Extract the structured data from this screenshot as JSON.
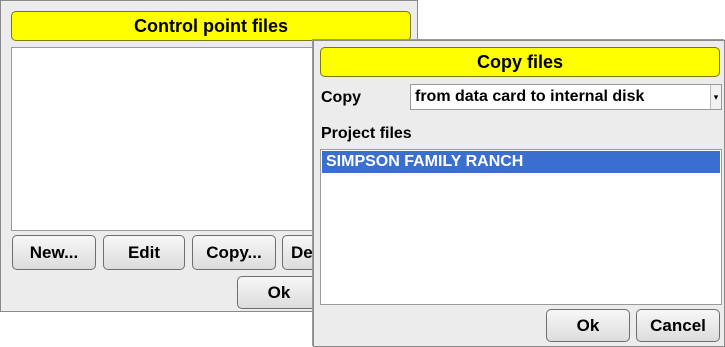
{
  "control_dialog": {
    "title": "Control point files",
    "buttons": {
      "new": "New...",
      "edit": "Edit",
      "copy": "Copy...",
      "delete_partial": "De",
      "ok": "Ok"
    }
  },
  "copy_dialog": {
    "title": "Copy files",
    "copy_label": "Copy",
    "copy_option": "from data card to internal disk",
    "dropdown_arrow": "▾",
    "project_files_label": "Project files",
    "project_files": [
      "SIMPSON FAMILY RANCH"
    ],
    "buttons": {
      "ok": "Ok",
      "cancel": "Cancel"
    }
  },
  "colors": {
    "title_bg": "#ffff00",
    "selection": "#3b6fcf"
  }
}
